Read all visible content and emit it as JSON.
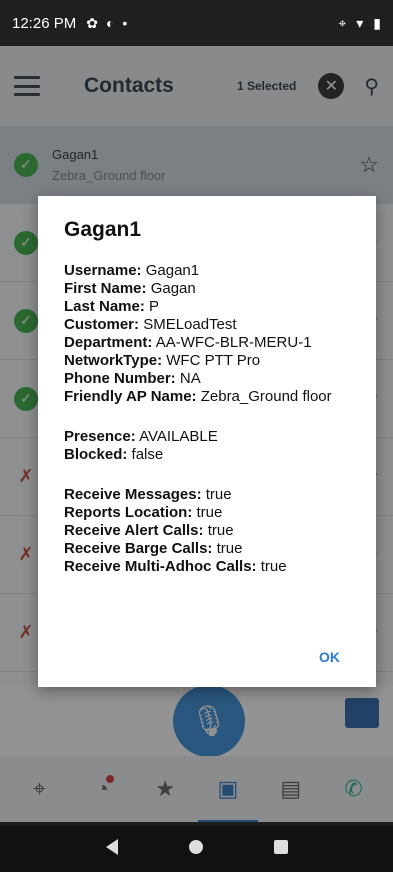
{
  "status_bar": {
    "time": "12:26 PM"
  },
  "app_bar": {
    "title": "Contacts",
    "selected_count": "1 Selected"
  },
  "contacts": [
    {
      "name": "Gagan1",
      "sub": "Zebra_Ground floor"
    }
  ],
  "dialog": {
    "title": "Gagan1",
    "group1": [
      {
        "label": "Username:",
        "value": "Gagan1"
      },
      {
        "label": "First Name:",
        "value": "Gagan"
      },
      {
        "label": "Last Name:",
        "value": "P"
      },
      {
        "label": "Customer:",
        "value": "SMELoadTest"
      },
      {
        "label": "Department:",
        "value": "AA-WFC-BLR-MERU-1"
      },
      {
        "label": "NetworkType:",
        "value": "WFC PTT Pro"
      },
      {
        "label": "Phone Number:",
        "value": "NA"
      },
      {
        "label": "Friendly AP Name:",
        "value": "Zebra_Ground floor"
      }
    ],
    "group2": [
      {
        "label": "Presence:",
        "value": "AVAILABLE"
      },
      {
        "label": "Blocked:",
        "value": "false"
      }
    ],
    "group3": [
      {
        "label": "Receive Messages:",
        "value": "true"
      },
      {
        "label": "Reports Location:",
        "value": "true"
      },
      {
        "label": "Receive Alert Calls:",
        "value": "true"
      },
      {
        "label": "Receive Barge Calls:",
        "value": "true"
      },
      {
        "label": "Receive Multi-Adhoc Calls:",
        "value": "true"
      }
    ],
    "ok_label": "OK"
  },
  "colors": {
    "accent": "#2a7bd6",
    "available": "#2eaa38",
    "fab": "#2b86d6"
  },
  "icons": {
    "status": [
      "settings-icon",
      "app-icon",
      "location-icon",
      "wifi-icon",
      "battery-icon"
    ],
    "bottom_nav": [
      "location-icon",
      "recents-icon",
      "favorites-star-icon",
      "contacts-icon",
      "groups-icon",
      "call-icon"
    ]
  }
}
